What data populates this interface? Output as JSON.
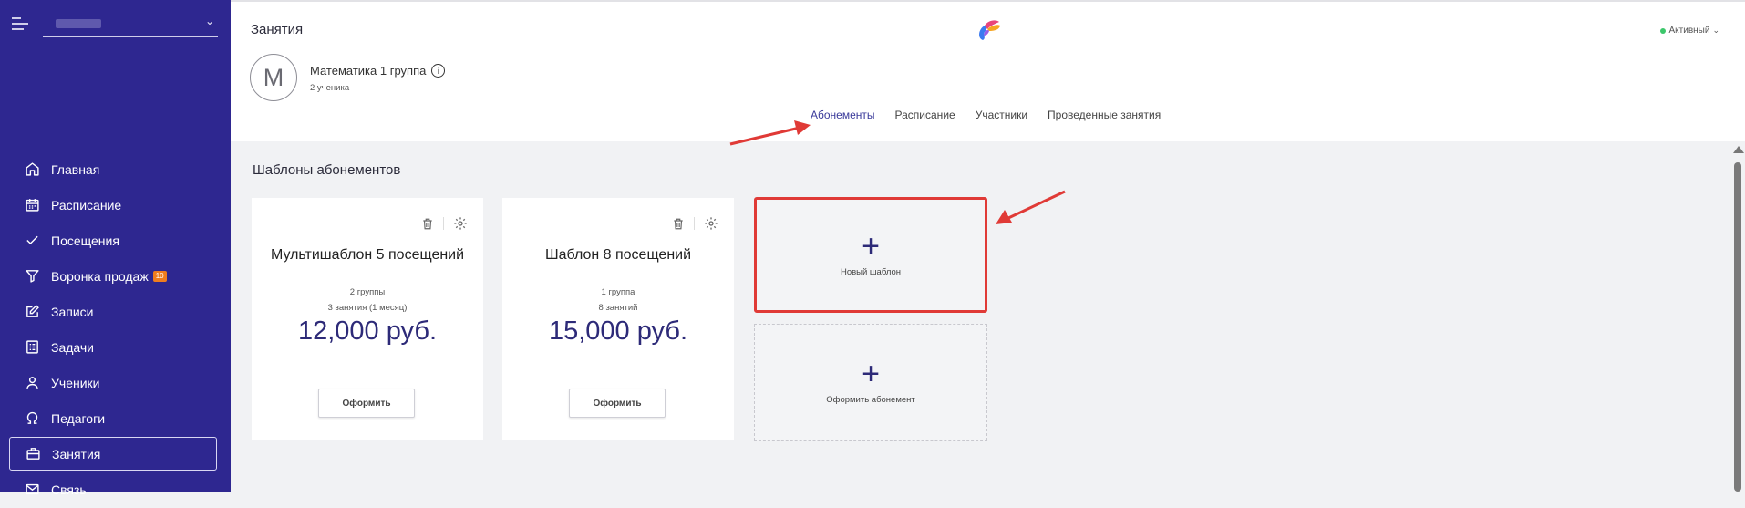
{
  "colors": {
    "sidebar_bg": "#2e2790",
    "accent": "#2d2a78",
    "active_status": "#3cc76b",
    "highlight": "#e03a36",
    "badge": "#ef7d1f"
  },
  "sidebar": {
    "items": [
      {
        "label": "Главная",
        "icon": "home-icon"
      },
      {
        "label": "Расписание",
        "icon": "calendar-icon"
      },
      {
        "label": "Посещения",
        "icon": "check-icon"
      },
      {
        "label": "Воронка продаж",
        "icon": "funnel-icon",
        "badge": "10"
      },
      {
        "label": "Записи",
        "icon": "edit-icon"
      },
      {
        "label": "Задачи",
        "icon": "tasks-icon"
      },
      {
        "label": "Ученики",
        "icon": "user-icon"
      },
      {
        "label": "Педагоги",
        "icon": "teacher-icon"
      },
      {
        "label": "Занятия",
        "icon": "briefcase-icon",
        "active": true
      },
      {
        "label": "Связь",
        "icon": "mail-icon"
      }
    ]
  },
  "header": {
    "title": "Занятия",
    "status": "Активный"
  },
  "group": {
    "avatar_letter": "M",
    "name": "Математика 1 группа",
    "info": "i",
    "subtitle": "2 ученика"
  },
  "tabs": [
    {
      "label": "Абонементы",
      "active": true
    },
    {
      "label": "Расписание"
    },
    {
      "label": "Участники"
    },
    {
      "label": "Проведенные занятия"
    }
  ],
  "main": {
    "section_title": "Шаблоны абонементов",
    "cards": [
      {
        "title": "Мультишаблон 5 посещений",
        "line1": "2 группы",
        "line2": "3 занятия (1 месяц)",
        "price": "12,000 руб.",
        "button": "Оформить"
      },
      {
        "title": "Шаблон 8 посещений",
        "line1": "1 группа",
        "line2": "8 занятий",
        "price": "15,000 руб.",
        "button": "Оформить"
      }
    ],
    "new_template": {
      "plus": "+",
      "label": "Новый шаблон"
    },
    "issue_subscription": {
      "plus": "+",
      "label": "Оформить абонемент"
    }
  }
}
